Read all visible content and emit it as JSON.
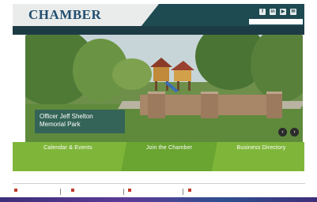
{
  "header": {
    "logo_subtitle": "",
    "logo": "CHAMBER",
    "logo_tagline": "",
    "search_placeholder": "",
    "social": [
      {
        "icon": "facebook-icon",
        "glyph": "f"
      },
      {
        "icon": "linkedin-icon",
        "glyph": "in"
      },
      {
        "icon": "youtube-icon",
        "glyph": "▶"
      },
      {
        "icon": "email-icon",
        "glyph": "✉"
      }
    ]
  },
  "nav": {
    "items": [
      "",
      "",
      "",
      "",
      "",
      "",
      ""
    ]
  },
  "hero": {
    "caption": "Officer Jeff Shelton Memorial Park",
    "prev_glyph": "‹",
    "next_glyph": "›"
  },
  "promo": {
    "items": [
      {
        "title": "Calendar & Events",
        "desc": ""
      },
      {
        "title": "Join the Chamber",
        "desc": ""
      },
      {
        "title": "Business Directory",
        "desc": ""
      }
    ]
  },
  "ticker": {
    "items": [
      "",
      "",
      "",
      ""
    ],
    "right_link": ""
  },
  "colors": {
    "header": "#1e4b52",
    "nav": "#1d3b45",
    "promo": "#7fb63a",
    "accent": "#234e6e"
  }
}
